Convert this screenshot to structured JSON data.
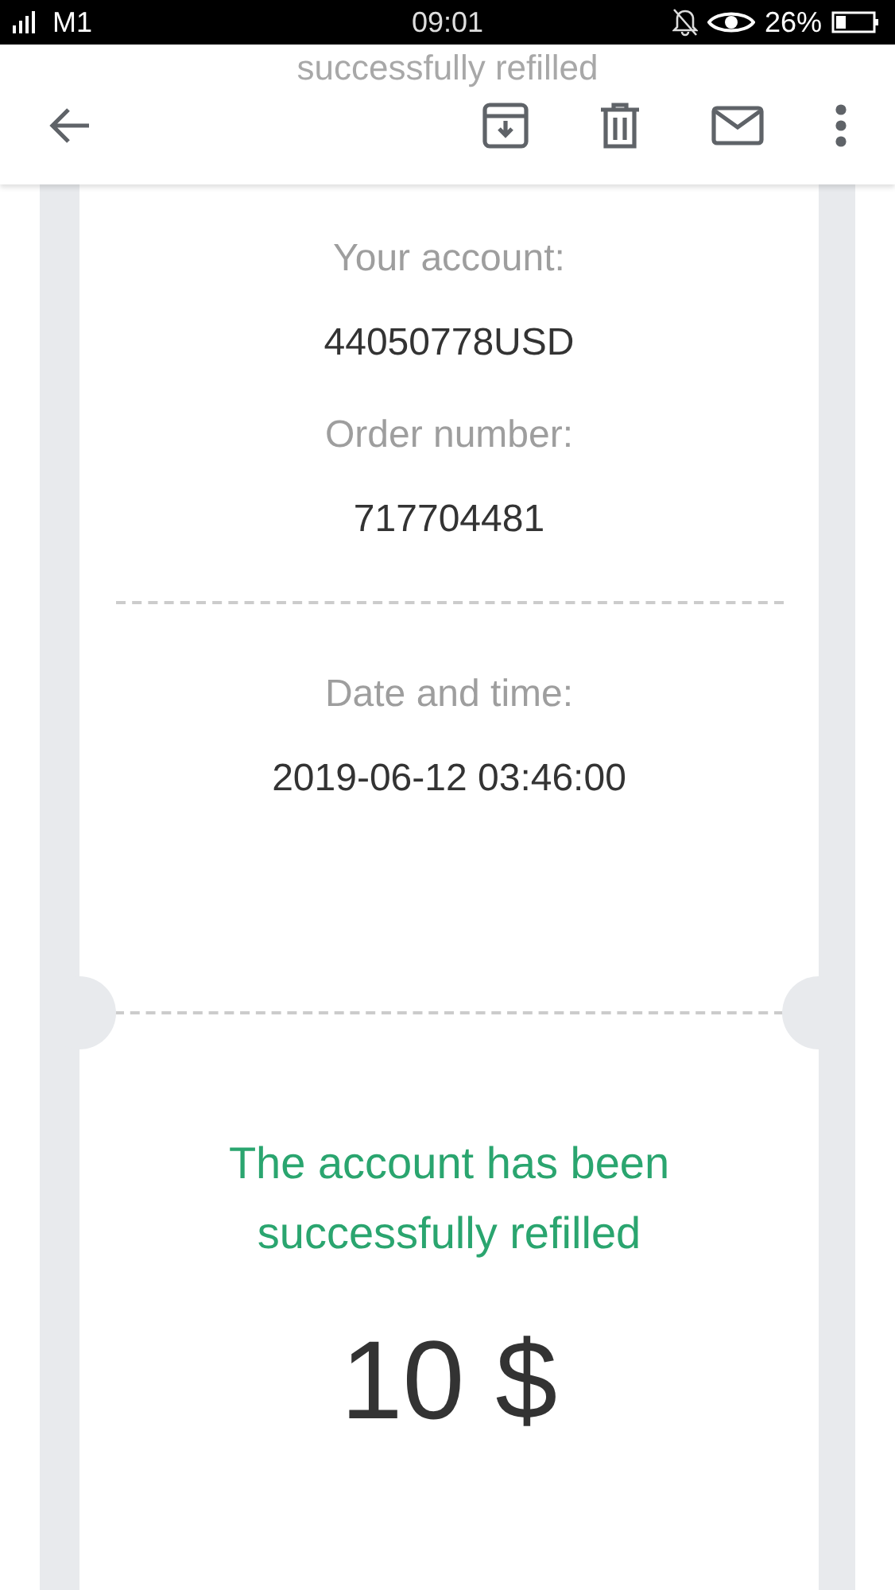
{
  "status_bar": {
    "carrier": "M1",
    "time": "09:01",
    "battery": "26%"
  },
  "app_bar": {
    "faded_title": "successfully refilled"
  },
  "receipt": {
    "fields": [
      {
        "label": "Your account:",
        "value": "44050778USD"
      },
      {
        "label": "Order number:",
        "value": "717704481"
      },
      {
        "label": "Date and time:",
        "value": "2019-06-12 03:46:00"
      }
    ],
    "message": "The account has been successfully refilled",
    "amount": "10 $"
  }
}
